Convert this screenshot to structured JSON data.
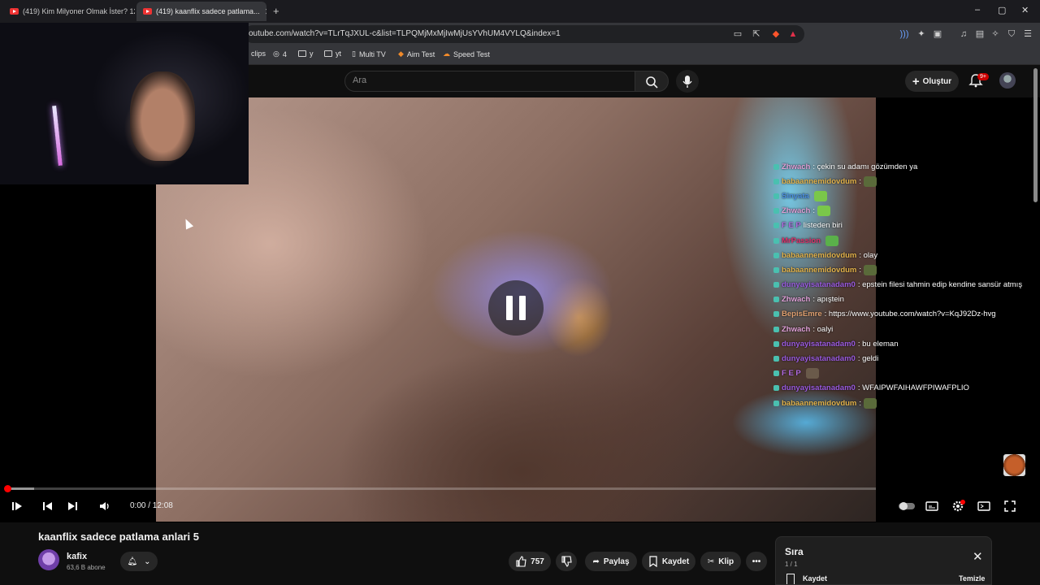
{
  "browser": {
    "tabs": [
      {
        "label": "(419) Kim Milyoner Olmak İster? 120...",
        "active": false
      },
      {
        "label": "(419) kaanflix sadece patlama...",
        "active": true
      }
    ],
    "new_tab": "+",
    "url": "outube.com/watch?v=TLrTqJXUL-c&list=TLPQMjMxMjIwMjUsYVhUM4VYLQ&index=1",
    "bookmarks": [
      "clips",
      "4",
      "y",
      "yt",
      "Multi TV",
      "Aim Test",
      "Speed Test"
    ],
    "window_controls": [
      "–",
      "▢",
      "✕"
    ]
  },
  "youtube": {
    "search_placeholder": "Ara",
    "create_label": "Oluştur",
    "notif_badge": "9+",
    "accent": "#ff0000"
  },
  "player": {
    "time": "0:00 / 12:08",
    "progress_fraction": 0.032,
    "state": "paused-icon-shown"
  },
  "chat": [
    {
      "user": "Zhwach",
      "color": "#e0a0d8",
      "msg": ": çekin su adamı gözümden ya"
    },
    {
      "user": "babaannemidovdum",
      "color": "#e3b24a",
      "msg": ":",
      "emote": "#5a6a3a"
    },
    {
      "user": "Sinyata",
      "color": "#4a8de0",
      "msg": "",
      "emote": "#7ac74a"
    },
    {
      "user": "Zhwach",
      "color": "#e0a0d8",
      "msg": ":",
      "emote": "#7ac74a"
    },
    {
      "user": "F E P",
      "color": "#b06ae0",
      "msg": " listeden biri"
    },
    {
      "user": "MrPassion",
      "color": "#e0306a",
      "msg": "",
      "emote": "#5ab04a"
    },
    {
      "user": "babaannemidovdum",
      "color": "#e3b24a",
      "msg": ": olay"
    },
    {
      "user": "babaannemidovdum",
      "color": "#e3b24a",
      "msg": ":",
      "emote": "#5a6a3a"
    },
    {
      "user": "dunyayisatanadam0",
      "color": "#9a5ae0",
      "msg": ": epstein filesi tahmin edip kendine sansür atmış"
    },
    {
      "user": "Zhwach",
      "color": "#e0a0d8",
      "msg": ": apıştein"
    },
    {
      "user": "BepisEmre",
      "color": "#e0a070",
      "msg": ": https://www.youtube.com/watch?v=KqJ92Dz-hvg"
    },
    {
      "user": "Zhwach",
      "color": "#e0a0d8",
      "msg": ": oalyi"
    },
    {
      "user": "dunyayisatanadam0",
      "color": "#9a5ae0",
      "msg": ": bu eleman"
    },
    {
      "user": "dunyayisatanadam0",
      "color": "#9a5ae0",
      "msg": ": geldi"
    },
    {
      "user": "F E P",
      "color": "#b06ae0",
      "msg": "",
      "emote": "#6a5a4a"
    },
    {
      "user": "dunyayisatanadam0",
      "color": "#9a5ae0",
      "msg": ": WFAIPWFAIHAWFPIWAFPLIO"
    },
    {
      "user": "babaannemidovdum",
      "color": "#e3b24a",
      "msg": ":",
      "emote": "#5a6a3a"
    }
  ],
  "video": {
    "title": "kaanflix sadece patlama anlari 5",
    "channel": "kafix",
    "subscribers": "63,6 B abone",
    "likes": "757",
    "share": "Paylaş",
    "save": "Kaydet",
    "clip": "Klip",
    "more": "•••"
  },
  "queue": {
    "title": "Sıra",
    "count": "1 / 1",
    "save": "Kaydet",
    "clear": "Temizle"
  }
}
